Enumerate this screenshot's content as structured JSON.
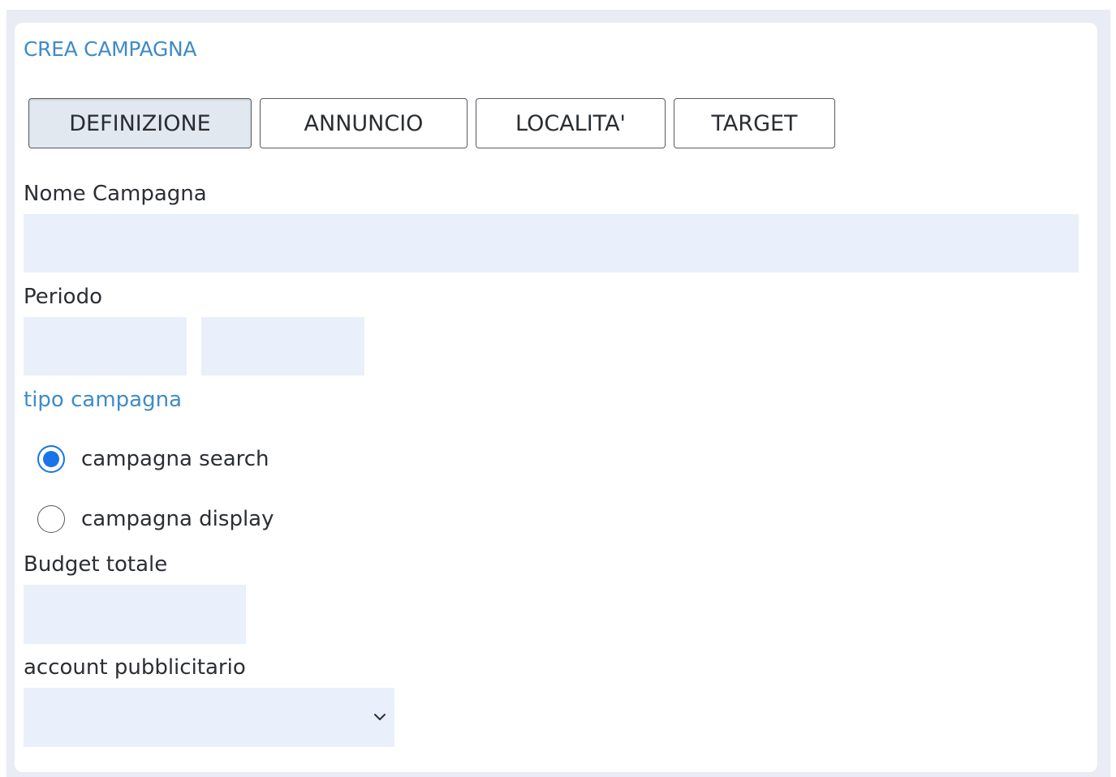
{
  "page": {
    "title": "CREA CAMPAGNA"
  },
  "tabs": [
    {
      "label": "DEFINIZIONE",
      "active": true
    },
    {
      "label": "ANNUNCIO",
      "active": false
    },
    {
      "label": "LOCALITA'",
      "active": false
    },
    {
      "label": "TARGET",
      "active": false
    }
  ],
  "form": {
    "campaign_name": {
      "label": "Nome Campagna",
      "value": ""
    },
    "period": {
      "label": "Periodo",
      "start_value": "",
      "end_value": ""
    },
    "campaign_type": {
      "label": "tipo campagna",
      "options": [
        {
          "label": "campagna search",
          "checked": true
        },
        {
          "label": "campagna display",
          "checked": false
        }
      ]
    },
    "budget": {
      "label": "Budget totale",
      "value": ""
    },
    "ad_account": {
      "label": "account pubblicitario",
      "selected": "",
      "icon": "chevron-down-icon"
    }
  },
  "colors": {
    "accent": "#3f8bc9",
    "input_bg": "#e9f0fb",
    "radio_checked": "#1a73e8",
    "active_tab_bg": "#e2e8ef"
  }
}
